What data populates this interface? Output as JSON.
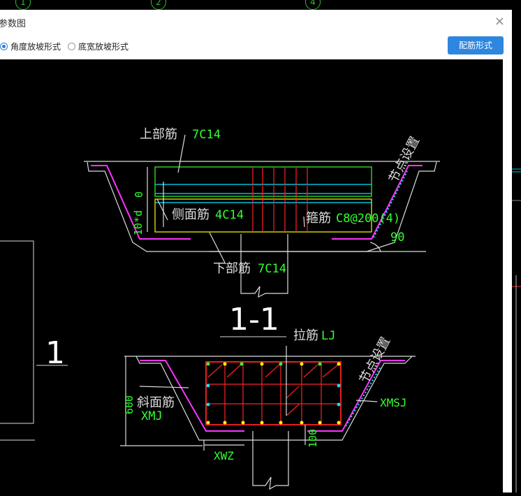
{
  "axis_bubbles": [
    "1",
    "2",
    "4"
  ],
  "dialog": {
    "title": "参数图",
    "close_glyph": "×"
  },
  "options": [
    {
      "label": "角度放坡形式",
      "selected": true
    },
    {
      "label": "底宽放坡形式",
      "selected": false
    }
  ],
  "button_label": "配筋形式",
  "section_top": {
    "top_bar_label": "上部筋",
    "top_bar_value": "7C14",
    "side_bar_label": "侧面筋",
    "side_bar_value": "4C14",
    "stirrup_label": "箍筋",
    "stirrup_value": "C8@200(4)",
    "bottom_bar_label": "下部筋",
    "bottom_bar_value": "7C14",
    "node_label": "节点设置",
    "angle": "90",
    "dim_zero": "0",
    "dim_d": "10*d"
  },
  "section_title": "1-1",
  "left_mark": "1",
  "section_bottom": {
    "tie_label": "拉筋",
    "tie_value": "LJ",
    "slope_label": "斜面筋",
    "slope_value": "XMJ",
    "node_label": "节点设置",
    "xmsj": "XMSJ",
    "xwz": "XWZ",
    "dim_600": "600",
    "dim_100": "100"
  }
}
